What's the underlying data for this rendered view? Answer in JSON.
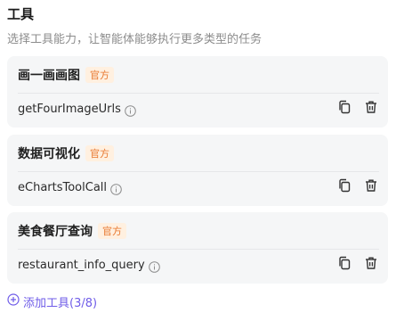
{
  "section": {
    "title": "工具",
    "subtitle": "选择工具能力，让智能体能够执行更多类型的任务"
  },
  "tools": [
    {
      "name": "画一画画图",
      "badge": "官方",
      "function": "getFourImageUrls"
    },
    {
      "name": "数据可视化",
      "badge": "官方",
      "function": "eChartsToolCall"
    },
    {
      "name": "美食餐厅查询",
      "badge": "官方",
      "function": "restaurant_info_query"
    }
  ],
  "add_tool": {
    "label": "添加工具(3/8)"
  },
  "colors": {
    "accent": "#6f5ce8",
    "badge_text": "#e8772e",
    "badge_bg": "#fff0e0",
    "card_bg": "#f5f6f7"
  }
}
